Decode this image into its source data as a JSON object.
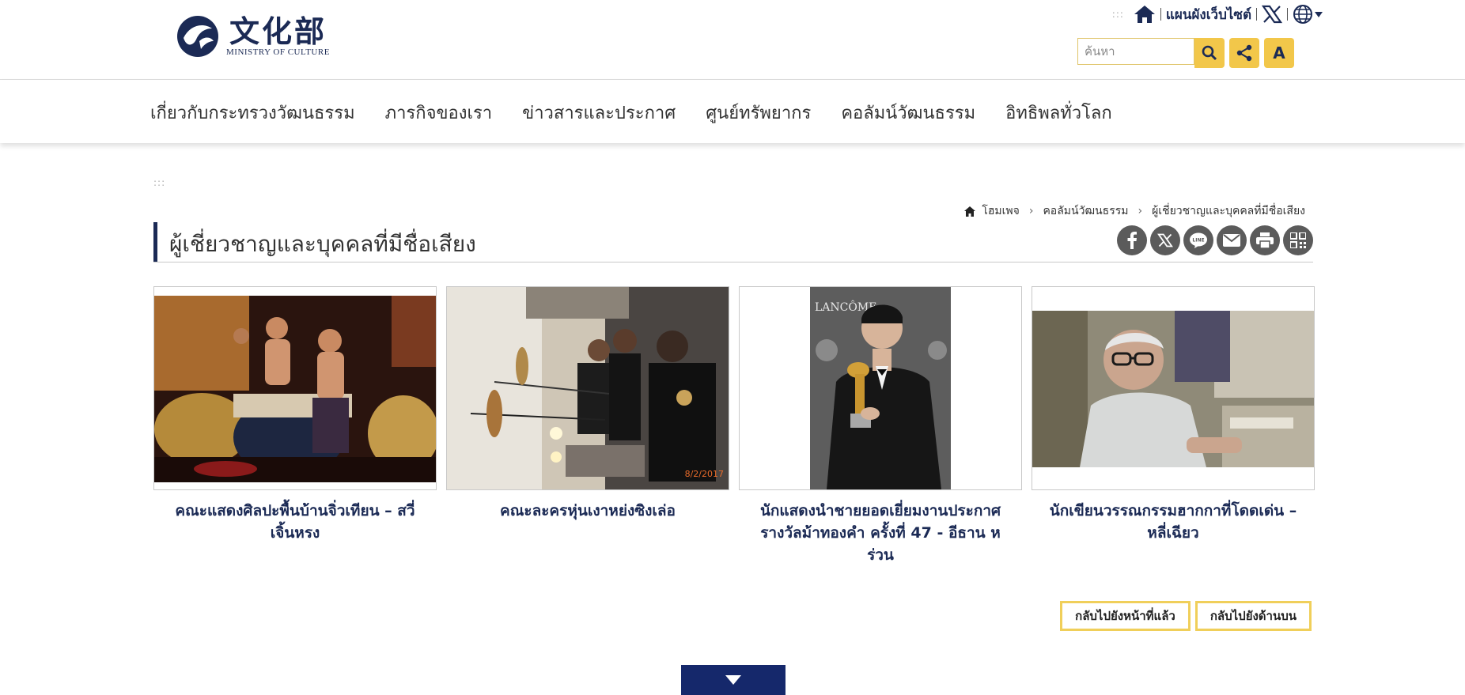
{
  "header": {
    "logo_cjk": "文化部",
    "logo_en": "MINISTRY OF CULTURE",
    "accesskey": ":::",
    "sitemap_label": "แผนผังเว็บไซต์",
    "search_placeholder": "ค้นหา",
    "font_size_button": "A",
    "icons": [
      "home-icon",
      "x-icon",
      "globe-icon",
      "search-icon",
      "share-icon"
    ]
  },
  "nav": {
    "items": [
      "เกี่ยวกับกระทรวงวัฒนธรรม",
      "ภารกิจของเรา",
      "ข่าวสารและประกาศ",
      "ศูนย์ทรัพยากร",
      "คอลัมน์วัฒนธรรม",
      "อิทธิพลทั่วโลก"
    ]
  },
  "content": {
    "accesskey": ":::",
    "breadcrumb": [
      "โฮมเพจ",
      "คอลัมน์วัฒนธรรม",
      "ผู้เชี่ยวชาญและบุคคลที่มีชื่อเสียง"
    ],
    "page_title": "ผู้เชี่ยวชาญและบุคคลที่มีชื่อเสียง",
    "share_icons": [
      "facebook-icon",
      "x-icon",
      "line-icon",
      "email-icon",
      "print-icon",
      "qrcode-icon"
    ],
    "cards": [
      {
        "caption": "คณะแสดงศิลปะพื้นบ้านจิ่วเทียน – สวี่เจิ้นหรง"
      },
      {
        "caption": "คณะละครหุ่นเงาหย่งซิงเล่อ",
        "photo_date": "8/2/2017"
      },
      {
        "caption": "นักแสดงนำชายยอดเยี่ยมงานประกาศรางวัลม้าทองคำ ครั้งที่ 47 - อีธาน หร่วน",
        "photo_text": "LANCÔME"
      },
      {
        "caption": "นักเขียนวรรณกรรมฮากกาที่โดดเด่น – หลี่เฉียว"
      }
    ],
    "back_prev": "กลับไปยังหน้าที่แล้ว",
    "back_top": "กลับไปยังด้านบน"
  },
  "colors": {
    "navy": "#1b2a55",
    "accent_yellow": "#f2c74a",
    "footer_blue": "#15286b"
  }
}
